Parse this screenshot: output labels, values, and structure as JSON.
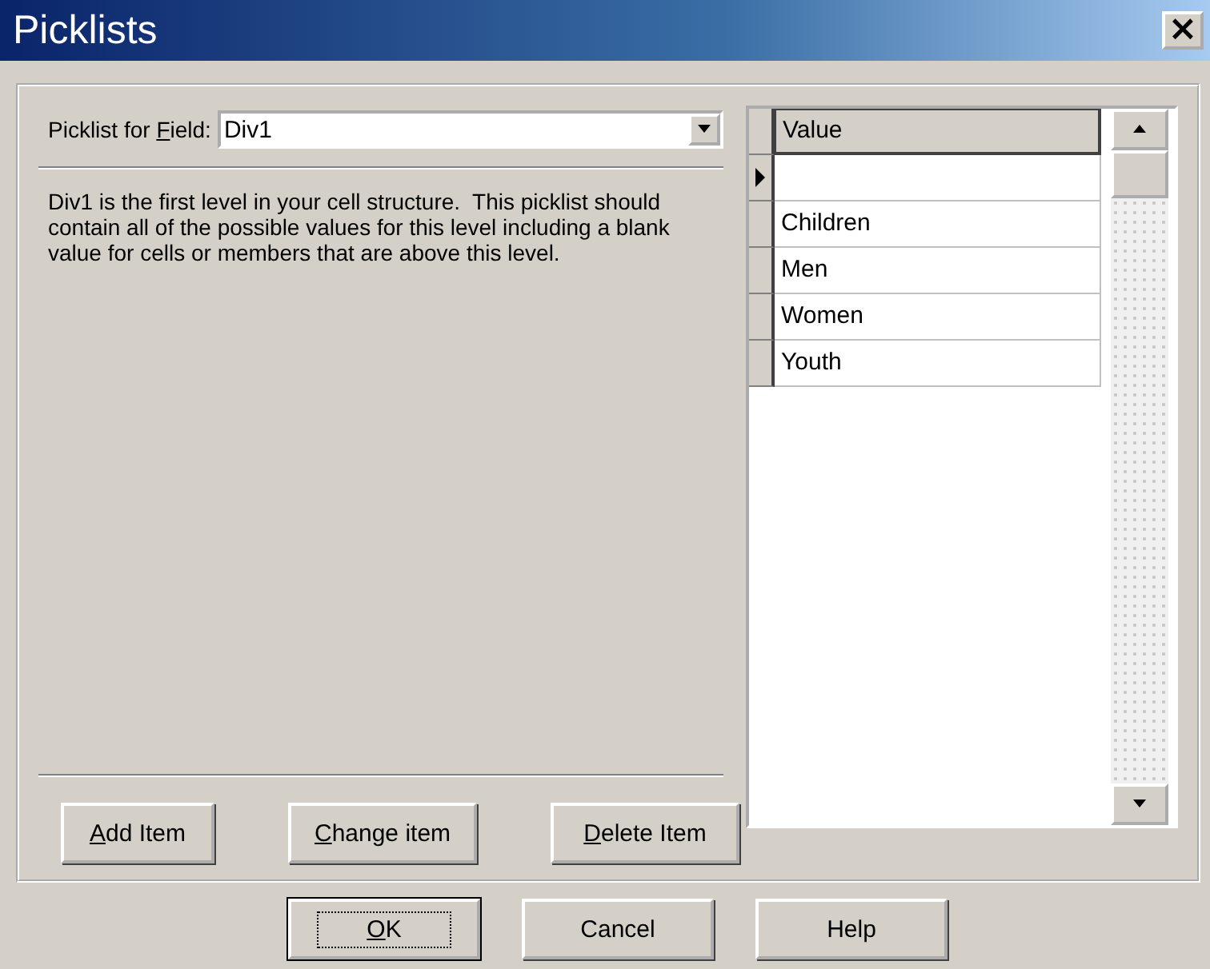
{
  "window": {
    "title": "Picklists",
    "close": "×"
  },
  "field": {
    "label_before": "Picklist for ",
    "access_key": "F",
    "label_rest": "ield:",
    "value": "Div1"
  },
  "description": "Div1 is the first level in your cell structure.  This picklist should contain all of the possible values for this level including a blank value for cells or members that are above this level.",
  "item_buttons": [
    {
      "access_key": "A",
      "label_rest": "dd Item"
    },
    {
      "access_key": "C",
      "label_rest": "hange item"
    },
    {
      "access_key": "D",
      "label_rest": "elete Item"
    }
  ],
  "grid": {
    "column": "Value",
    "rows": [
      {
        "value": "",
        "selected": true
      },
      {
        "value": "Children",
        "selected": false
      },
      {
        "value": "Men",
        "selected": false
      },
      {
        "value": "Women",
        "selected": false
      },
      {
        "value": "Youth",
        "selected": false
      }
    ]
  },
  "dialog_buttons": [
    {
      "access_key": "O",
      "label_rest": "K",
      "default": true
    },
    {
      "label_rest": "Cancel",
      "default": false
    },
    {
      "label_rest": "Help",
      "default": false
    }
  ]
}
